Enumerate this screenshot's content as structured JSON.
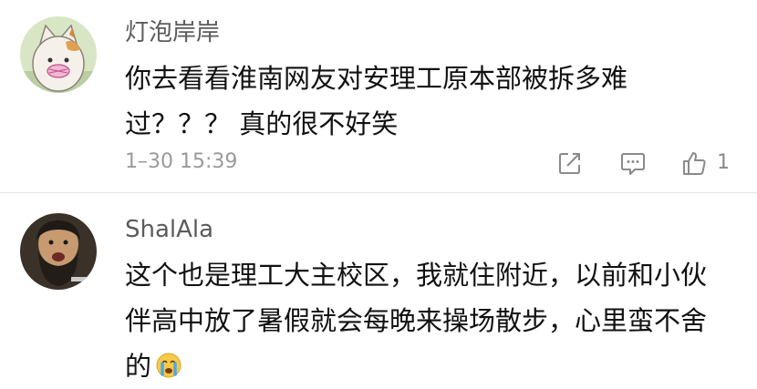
{
  "comments": [
    {
      "username": "灯泡岸岸",
      "text_lines": [
        "你去看看淮南网友对安理工原本部被拆多难",
        "过？？？ 真的很不好笑"
      ],
      "timestamp": "1–30 15:39",
      "like_count": "1"
    },
    {
      "username": "ShalAla",
      "text_lines": [
        "这个也是理工大主校区，我就住附近，以前和小伙",
        "伴高中放了暑假就会每晚来操场散步，心里蛮不舍",
        "的"
      ],
      "emoji": "crying-emoji"
    }
  ],
  "icons": {
    "share": "share-icon",
    "reply": "comment-icon",
    "like": "thumbs-up-icon"
  },
  "colors": {
    "username": "#5b5b5b",
    "text": "#111111",
    "meta": "#9a9a9a",
    "divider": "#e4e4e4"
  }
}
